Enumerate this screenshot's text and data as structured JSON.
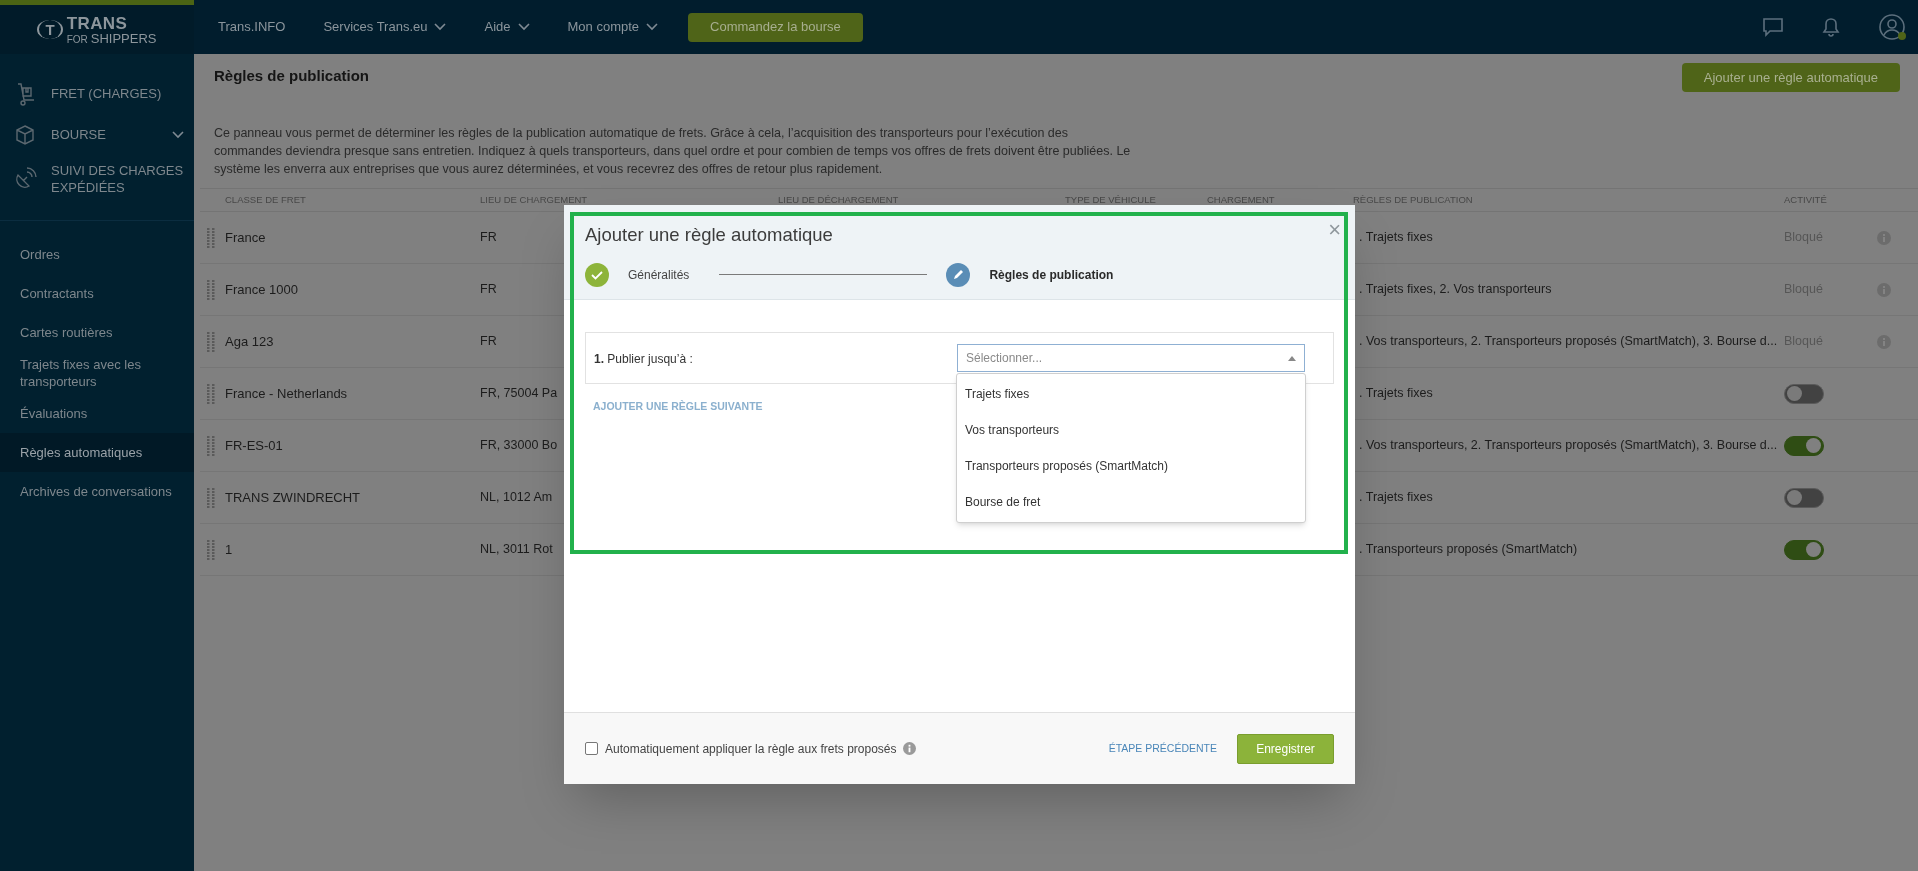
{
  "logo": {
    "mark": "T",
    "name": "TRANS",
    "tagline_1": "FOR",
    "tagline_2": "SHIPPERS"
  },
  "top_nav": [
    {
      "label": "Trans.INFO",
      "dropdown": false
    },
    {
      "label": "Services Trans.eu",
      "dropdown": true
    },
    {
      "label": "Aide",
      "dropdown": true
    },
    {
      "label": "Mon compte",
      "dropdown": true
    }
  ],
  "top_button": "Commandez la bourse",
  "top_icons": [
    {
      "kind": "chat"
    },
    {
      "kind": "bell"
    },
    {
      "kind": "user"
    }
  ],
  "sidebar": {
    "main_items": [
      {
        "label": "FRET (CHARGES)",
        "expandable": false
      },
      {
        "label": "BOURSE",
        "expandable": true
      },
      {
        "label": "SUIVI DES CHARGES EXPÉDIÉES",
        "expandable": false
      }
    ],
    "items": [
      {
        "label": "Ordres",
        "selected": false
      },
      {
        "label": "Contractants",
        "selected": false
      },
      {
        "label": "Cartes routières",
        "selected": false
      },
      {
        "label": "Trajets fixes avec les transporteurs",
        "selected": false
      },
      {
        "label": "Évaluations",
        "selected": false
      },
      {
        "label": "Règles automatiques",
        "selected": true
      },
      {
        "label": "Archives de conversations",
        "selected": false
      }
    ]
  },
  "page": {
    "title": "Règles de publication",
    "add_button": "Ajouter une règle automatique",
    "description": "Ce panneau vous permet de déterminer les règles de la publication automatique de frets. Grâce à cela, l’acquisition des transporteurs pour l’exécution des commandes deviendra presque sans entretien. Indiquez à quels transporteurs, dans quel ordre et pour combien de temps vos offres de frets doivent être publiées. Le système les enverra aux entreprises que vous aurez déterminées, et vous recevrez des offres de retour plus rapidement."
  },
  "table": {
    "columns": [
      "CLASSE DE FRET",
      "LIEU DE CHARGEMENT",
      "LIEU DE DÉCHARGEMENT",
      "TYPE DE VÉHICULE",
      "CHARGEMENT",
      "RÈGLES DE PUBLICATION",
      "ACTIVITÉ"
    ],
    "rows": [
      {
        "name": "France",
        "loading": "FR",
        "rules": ". Trajets fixes",
        "activity": {
          "kind": "status",
          "text": "Bloqué"
        }
      },
      {
        "name": "France 1000",
        "loading": "FR",
        "rules": ". Trajets fixes, 2. Vos transporteurs",
        "activity": {
          "kind": "status",
          "text": "Bloqué"
        }
      },
      {
        "name": "Aga 123",
        "loading": "FR",
        "rules": ". Vos transporteurs, 2. Transporteurs proposés (SmartMatch), 3. Bourse d...",
        "activity": {
          "kind": "status",
          "text": "Bloqué"
        }
      },
      {
        "name": "France - Netherlands",
        "loading": "FR, 75004 Pa",
        "rules": ". Trajets fixes",
        "activity": {
          "kind": "toggle",
          "on": false
        }
      },
      {
        "name": "FR-ES-01",
        "loading": "FR, 33000 Bo",
        "rules": ". Vos transporteurs, 2. Transporteurs proposés (SmartMatch), 3. Bourse d...",
        "activity": {
          "kind": "toggle",
          "on": true
        }
      },
      {
        "name": "TRANS ZWINDRECHT",
        "loading": "NL, 1012 Am",
        "rules": ". Trajets fixes",
        "activity": {
          "kind": "toggle",
          "on": false
        }
      },
      {
        "name": "1",
        "loading": "NL, 3011 Rot",
        "rules": ". Transporteurs proposés (SmartMatch)",
        "activity": {
          "kind": "toggle",
          "on": true
        }
      }
    ]
  },
  "modal": {
    "title": "Ajouter une règle automatique",
    "close": "×",
    "steps": [
      {
        "label": "Généralités",
        "completed": true
      },
      {
        "label": "Règles de publication",
        "completed": false
      }
    ],
    "rule": {
      "label": "**1.** Publier jusqu’à :",
      "select": {
        "placeholder": "Sélectionner...",
        "expanded": true,
        "options": [
          {
            "label": "Trajets fixes",
            "selected": false
          },
          {
            "label": "Vos transporteurs",
            "selected": false
          },
          {
            "label": "Transporteurs proposés (SmartMatch)",
            "selected": false
          },
          {
            "label": "Bourse de fret",
            "selected": false
          }
        ]
      }
    },
    "add_rule_link": "AJOUTER UNE RÈGLE SUIVANTE",
    "auto_apply": {
      "label": "Automatiquement appliquer la règle aux frets proposés",
      "checked": false
    },
    "back_link": "ÉTAPE PRÉCÉDENTE",
    "save_button": "Enregistrer"
  }
}
